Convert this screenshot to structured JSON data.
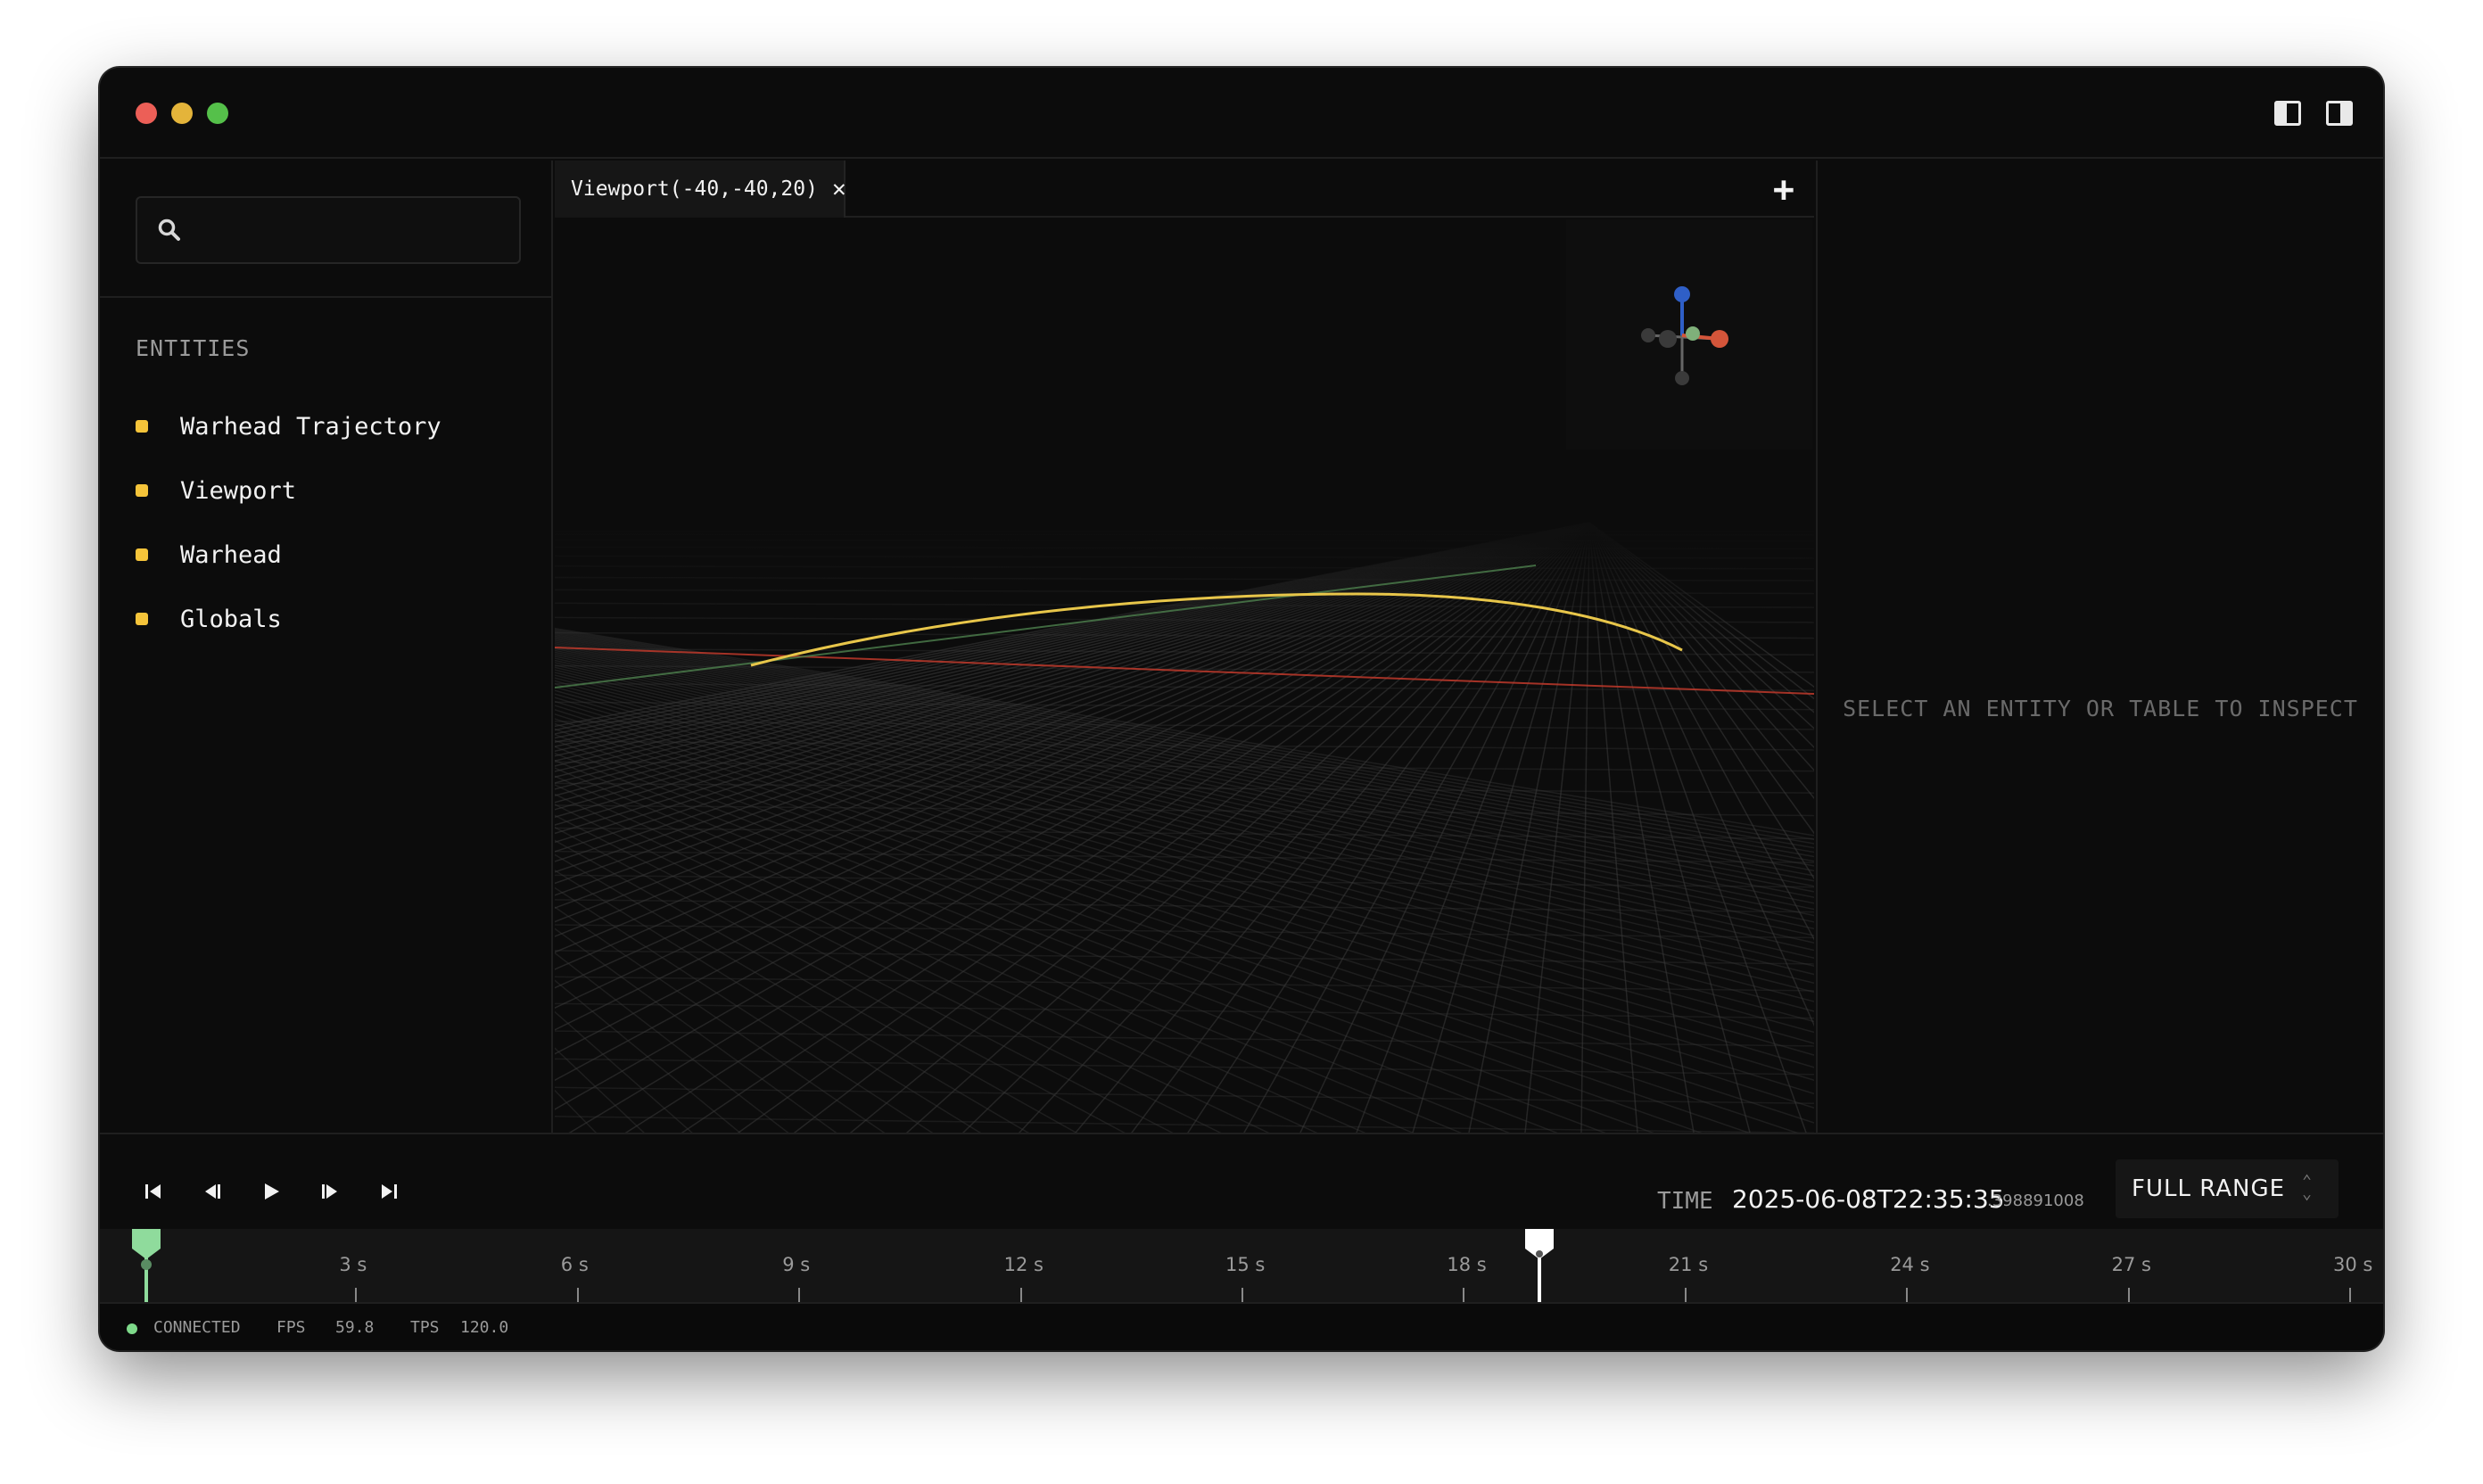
{
  "window": {
    "controls": [
      "close",
      "minimize",
      "maximize"
    ],
    "toggles": [
      "toggle-left-panel-icon",
      "toggle-right-panel-icon"
    ]
  },
  "sidebar": {
    "search": {
      "value": "",
      "placeholder": ""
    },
    "section_title": "ENTITIES",
    "entities": [
      {
        "label": "Warhead Trajectory",
        "color": "#f5c43a"
      },
      {
        "label": "Viewport",
        "color": "#f5c43a"
      },
      {
        "label": "Warhead",
        "color": "#f5c43a"
      },
      {
        "label": "Globals",
        "color": "#f5c43a"
      }
    ]
  },
  "viewport": {
    "tab_label": "Viewport(-40,-40,20)",
    "close_icon": "✕",
    "add_icon": "+",
    "colors": {
      "trajectory": "#e8c64a",
      "axis_x": "#c0392b",
      "axis_y": "#4a7a4a",
      "axis_z": "#2f5fc7",
      "grid": "#3a3a3a"
    }
  },
  "inspector": {
    "empty_message": "SELECT AN ENTITY OR TABLE TO INSPECT"
  },
  "transport": {
    "buttons": [
      "jump-to-start",
      "step-back",
      "play",
      "step-forward",
      "jump-to-end"
    ],
    "time_label": "TIME",
    "time_value": "2025-06-08T22:35:35",
    "time_fraction": ".398891008",
    "range_label": "FULL RANGE"
  },
  "timeline": {
    "ticks": [
      "3 s",
      "6 s",
      "9 s",
      "12 s",
      "15 s",
      "18 s",
      "21 s",
      "24 s",
      "27 s",
      "30 s"
    ],
    "range_start_s": 0,
    "playhead_s": 20.0,
    "max_s": 30,
    "colors": {
      "start_marker": "#8fdb9c",
      "playhead": "#ffffff"
    }
  },
  "status": {
    "connection": "CONNECTED",
    "connection_color": "#7ed98a",
    "fps_label": "FPS",
    "fps_value": "59.8",
    "tps_label": "TPS",
    "tps_value": "120.0"
  }
}
